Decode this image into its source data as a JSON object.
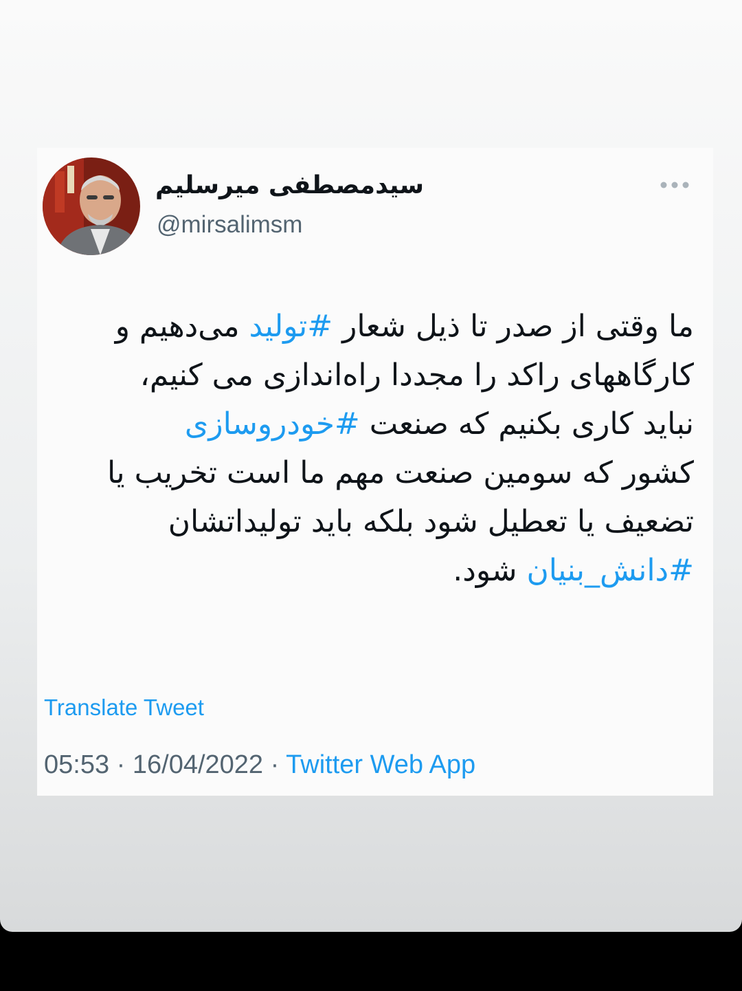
{
  "tweet": {
    "author": {
      "display_name": "سیدمصطفی میرسلیم",
      "handle": "@mirsalimsm",
      "avatar_icon": "profile-photo"
    },
    "more_icon": "ellipsis-icon",
    "text_lines": [
      {
        "segments": [
          {
            "text": "ما وقتی از صدر تا ذیل شعار ",
            "hashtag": false
          },
          {
            "text": "#تولید",
            "hashtag": true
          },
          {
            "text": " می‌دهیم و",
            "hashtag": false
          }
        ]
      },
      {
        "segments": [
          {
            "text": "کارگاههای راکد را مجددا راه‌اندازی می کنیم،",
            "hashtag": false
          }
        ]
      },
      {
        "segments": [
          {
            "text": "نباید کاری بکنیم که صنعت ",
            "hashtag": false
          },
          {
            "text": "#خودروسازی",
            "hashtag": true
          }
        ]
      },
      {
        "segments": [
          {
            "text": "کشور که سومین صنعت مهم ما است تخریب یا",
            "hashtag": false
          }
        ]
      },
      {
        "segments": [
          {
            "text": "تضعیف  یا تعطیل شود بلکه باید تولیداتشان",
            "hashtag": false
          }
        ]
      },
      {
        "segments": [
          {
            "text": "#دانش_بنیان",
            "hashtag": true
          },
          {
            "text": " شود.",
            "hashtag": false
          }
        ]
      }
    ],
    "translate_label": "Translate Tweet",
    "time": "05:53",
    "separator": "·",
    "date": "16/04/2022",
    "source": "Twitter Web App"
  },
  "colors": {
    "link": "#1d9bf0",
    "text": "#0f1419",
    "secondary": "#536471"
  }
}
